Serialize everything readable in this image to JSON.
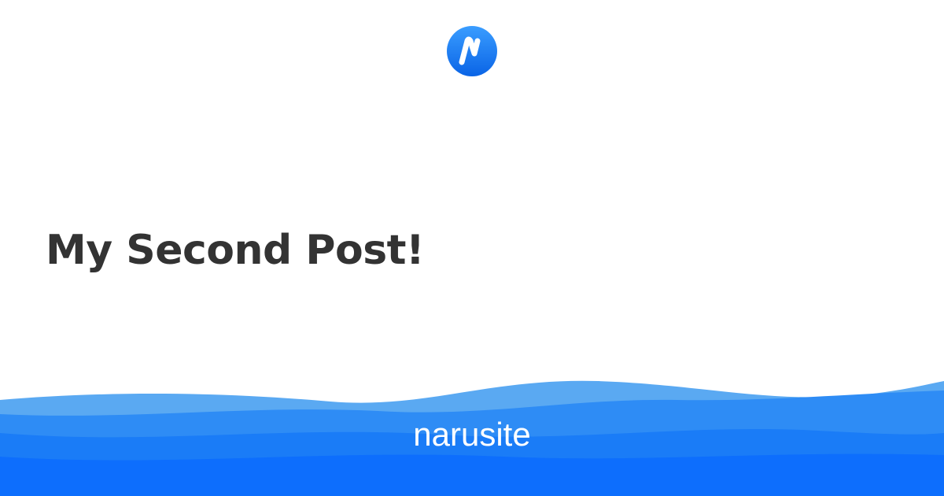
{
  "header": {
    "logo_icon": "narusite-n-logo-icon"
  },
  "post": {
    "title": "My Second Post!"
  },
  "footer": {
    "site_name": "narusite"
  },
  "colors": {
    "title_text": "#333333",
    "brand_blue": "#1877f2",
    "wave_light": "#5aa9f2",
    "wave_mid": "#2e8cf5",
    "wave_dark": "#0d6efd",
    "background": "#ffffff"
  }
}
